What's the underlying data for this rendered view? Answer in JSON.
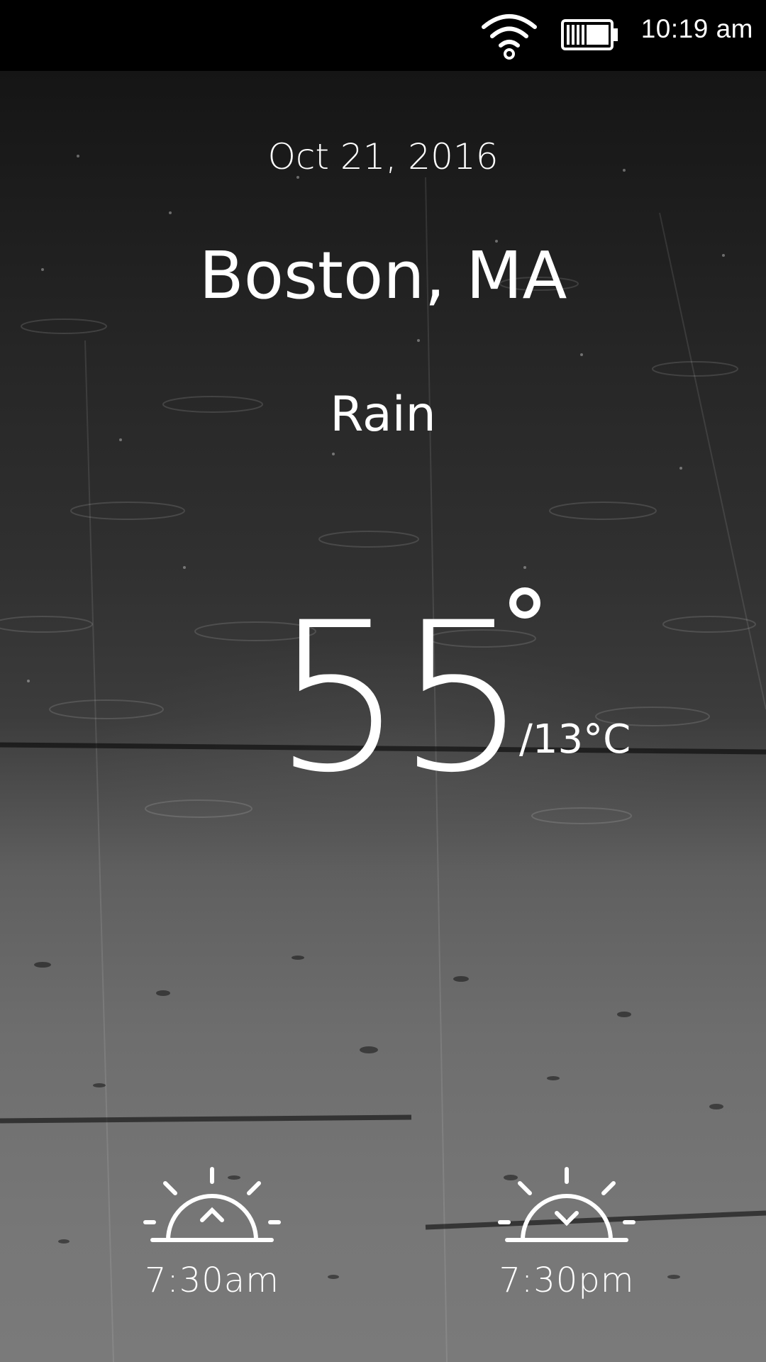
{
  "status_bar": {
    "time": "10:19 am",
    "wifi_icon": "wifi-icon",
    "battery_icon": "battery-icon"
  },
  "weather": {
    "date": "Oct 21, 2016",
    "location": "Boston, MA",
    "condition": "Rain",
    "temperature_f": "55",
    "temperature_c": "/13°C"
  },
  "sun": {
    "sunrise_icon": "sunrise-icon",
    "sunrise_time": "7:30am",
    "sunset_icon": "sunset-icon",
    "sunset_time": "7:30pm"
  },
  "colors": {
    "text": "#ffffff",
    "status_bar_bg": "#000000"
  }
}
